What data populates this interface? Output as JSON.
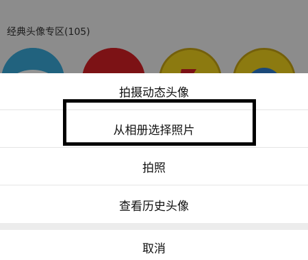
{
  "background": {
    "section_title": "经典头像专区(105)",
    "avatars": [
      "avatar-robot",
      "avatar-red",
      "avatar-lightning",
      "avatar-blue-character"
    ]
  },
  "action_sheet": {
    "items": [
      {
        "label": "拍摄动态头像"
      },
      {
        "label": "从相册选择照片"
      },
      {
        "label": "拍照"
      },
      {
        "label": "查看历史头像"
      }
    ],
    "cancel_label": "取消"
  },
  "colors": {
    "overlay": "rgba(0,0,0,0.42)",
    "highlight_border": "#000000"
  }
}
